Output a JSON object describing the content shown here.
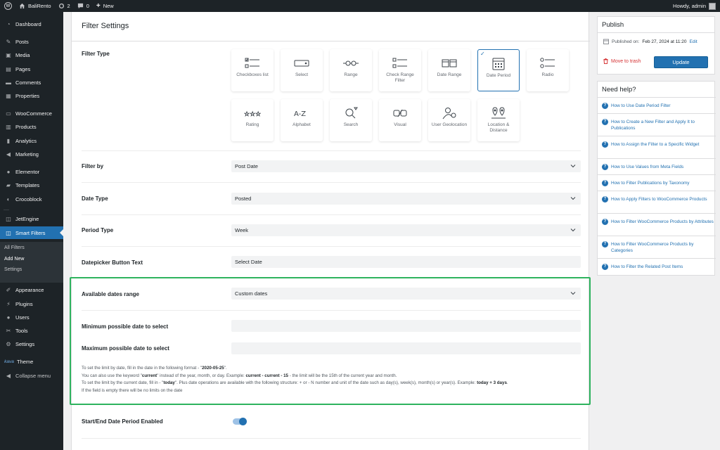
{
  "adminbar": {
    "site_name": "BaliRento",
    "updates_count": "2",
    "comments_count": "0",
    "new_label": "New",
    "howdy": "Howdy, admin"
  },
  "sidebar": {
    "items": [
      {
        "label": "Dashboard",
        "icon": "dashboard-icon"
      },
      {
        "label": "Posts",
        "icon": "pin-icon"
      },
      {
        "label": "Media",
        "icon": "media-icon"
      },
      {
        "label": "Pages",
        "icon": "page-icon"
      },
      {
        "label": "Comments",
        "icon": "comment-icon"
      },
      {
        "label": "Properties",
        "icon": "document-icon"
      },
      {
        "label": "WooCommerce",
        "icon": "woo-icon"
      },
      {
        "label": "Products",
        "icon": "archive-icon"
      },
      {
        "label": "Analytics",
        "icon": "chart-icon"
      },
      {
        "label": "Marketing",
        "icon": "megaphone-icon"
      },
      {
        "label": "Elementor",
        "icon": "elementor-icon"
      },
      {
        "label": "Templates",
        "icon": "folder-icon"
      },
      {
        "label": "Crocoblock",
        "icon": "crocoblock-icon"
      },
      {
        "label": "JetEngine",
        "icon": "jetengine-icon"
      },
      {
        "label": "Smart Filters",
        "icon": "smartfilters-icon"
      },
      {
        "label": "Appearance",
        "icon": "brush-icon"
      },
      {
        "label": "Plugins",
        "icon": "plugin-icon"
      },
      {
        "label": "Users",
        "icon": "user-icon"
      },
      {
        "label": "Tools",
        "icon": "wrench-icon"
      },
      {
        "label": "Settings",
        "icon": "settings-icon"
      },
      {
        "label": "Theme",
        "icon": "kava-icon"
      },
      {
        "label": "Collapse menu",
        "icon": "collapse-icon"
      }
    ],
    "submenu": [
      "All Filters",
      "Add New",
      "Settings"
    ],
    "theme_prefix": "kava"
  },
  "main": {
    "title": "Filter Settings",
    "filter_type_label": "Filter Type",
    "tiles": [
      {
        "label": "Checkboxes list",
        "icon": "checkboxes-icon"
      },
      {
        "label": "Select",
        "icon": "select-icon"
      },
      {
        "label": "Range",
        "icon": "range-icon"
      },
      {
        "label": "Check Range Filter",
        "icon": "check-range-icon"
      },
      {
        "label": "Date Range",
        "icon": "date-range-icon"
      },
      {
        "label": "Date Period",
        "icon": "calendar-icon",
        "selected": true
      },
      {
        "label": "Radio",
        "icon": "radio-icon"
      },
      {
        "label": "Rating",
        "icon": "stars-icon"
      },
      {
        "label": "Alphabet",
        "icon": "alphabet-icon"
      },
      {
        "label": "Search",
        "icon": "search-icon"
      },
      {
        "label": "Visual",
        "icon": "visual-icon"
      },
      {
        "label": "User Geolocation",
        "icon": "user-geolocation-icon"
      },
      {
        "label": "Location & Distance",
        "icon": "location-icon"
      }
    ],
    "filter_by": {
      "label": "Filter by",
      "value": "Post Date"
    },
    "date_type": {
      "label": "Date Type",
      "value": "Posted"
    },
    "period_type": {
      "label": "Period Type",
      "value": "Week"
    },
    "datepicker_text": {
      "label": "Datepicker Button Text",
      "value": "Select Date"
    },
    "available_dates": {
      "label": "Available dates range",
      "value": "Custom dates"
    },
    "min_date": {
      "label": "Minimum possible date to select",
      "value": ""
    },
    "max_date": {
      "label": "Maximum possible date to select",
      "value": ""
    },
    "help": {
      "l1a": "To set the limit by date, fill in the date in the following format - \"",
      "l1b": "2020-05-25",
      "l1c": "\".",
      "l2a": "You can also use the keyword \"",
      "l2b": "current",
      "l2c": "\" instead of the year, month, or day. Example: ",
      "l2d": "current - current - 15",
      "l2e": " - the limit will be the 15th of the current year and month.",
      "l3a": "To set the limit by the current date, fill in - \"",
      "l3b": "today",
      "l3c": "\". Plus date operations are available with the following structure: + or - N number and unit of the date such as day(s), week(s), month(s) or year(s). Example: ",
      "l3d": "today + 3 days",
      "l3e": ".",
      "l4": "If the field is empty there will be no limits on the date"
    },
    "start_end": {
      "label": "Start/End Date Period Enabled",
      "enabled": true
    }
  },
  "publish": {
    "title": "Publish",
    "published_on_label": "Published on:",
    "published_on_value": "Feb 27, 2024 at 11:20",
    "edit_label": "Edit",
    "trash_label": "Move to trash",
    "update_label": "Update"
  },
  "need_help": {
    "title": "Need help?",
    "links": [
      "How to Use Date Period Filter",
      "How to Create a New Filter and Apply It to Publications",
      "How to Assign the Filter to a Specific Widget",
      "How to Use Values from Meta Fields",
      "How to Filter Publications by Taxonomy",
      "How to Apply Filters to WooCommerce Products",
      "How to Filter WooCommerce Products by Attributes",
      "How to Filter WooCommerce Products by Categories",
      "How to Filter the Related Post Items"
    ]
  },
  "colors": {
    "accent": "#2271b1",
    "sidebar_bg": "#1d2327",
    "highlight": "#2eb35e",
    "danger": "#d63638"
  }
}
